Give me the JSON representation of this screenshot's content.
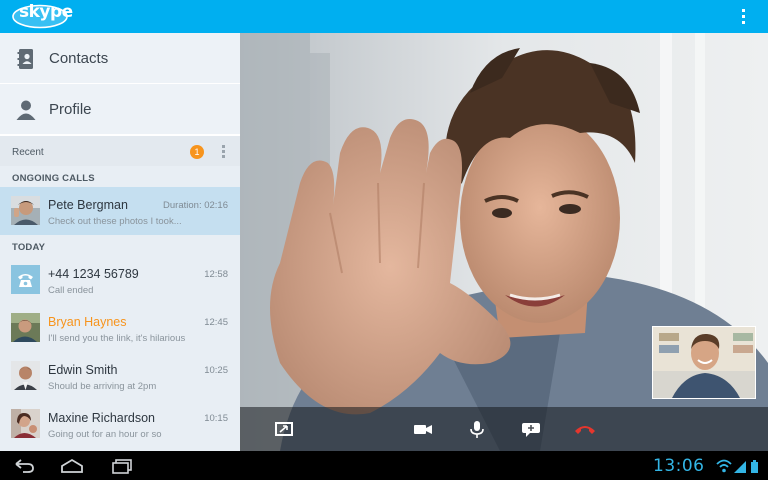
{
  "app": {
    "logo_text": "skype",
    "colors": {
      "brand": "#00aff0",
      "accent": "#f7941d",
      "system_clock": "#33b5e5"
    }
  },
  "sidebar": {
    "nav": [
      {
        "label": "Contacts",
        "icon": "contacts-book-icon"
      },
      {
        "label": "Profile",
        "icon": "profile-person-icon"
      }
    ],
    "recent": {
      "label": "Recent",
      "badge_count": "1"
    },
    "sections": [
      {
        "title": "ONGOING CALLS",
        "items": [
          {
            "name": "Pete Bergman",
            "subtitle": "Check out these photos I took...",
            "meta": "Duration: 02:16"
          }
        ]
      },
      {
        "title": "TODAY",
        "items": [
          {
            "name": "+44 1234 56789",
            "subtitle": "Call ended",
            "meta": "12:58"
          },
          {
            "name": "Bryan Haynes",
            "subtitle": "I'll send you the link, it's hilarious",
            "meta": "12:45"
          },
          {
            "name": "Edwin Smith",
            "subtitle": "Should be arriving at 2pm",
            "meta": "10:25"
          },
          {
            "name": "Maxine Richardson",
            "subtitle": "Going out for an hour or so",
            "meta": "10:15"
          }
        ]
      }
    ]
  },
  "call_controls": [
    {
      "name": "fullscreen-toggle-icon"
    },
    {
      "name": "video-camera-icon"
    },
    {
      "name": "microphone-icon"
    },
    {
      "name": "chat-bubble-icon"
    },
    {
      "name": "end-call-icon"
    }
  ],
  "system_bar": {
    "time": "13:06",
    "buttons": [
      "back-icon",
      "home-icon",
      "recent-apps-icon"
    ]
  }
}
